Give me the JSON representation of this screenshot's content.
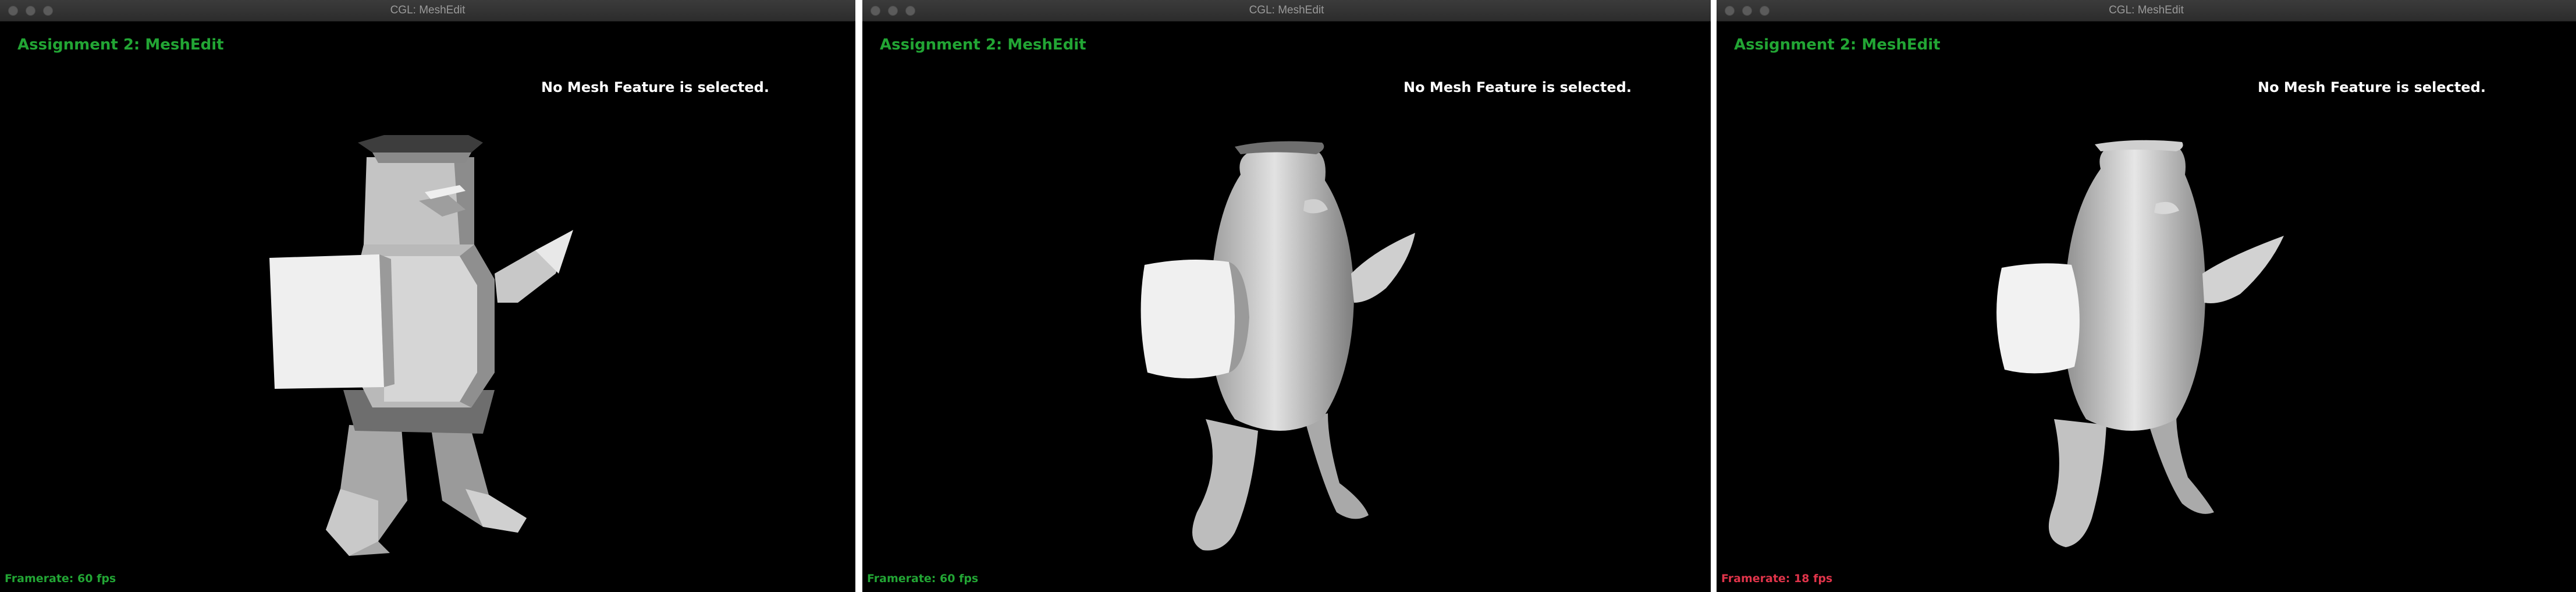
{
  "windows": [
    {
      "window_title": "CGL: MeshEdit",
      "app_title": "Assignment 2: MeshEdit",
      "status_message": "No Mesh Feature is selected.",
      "framerate": "Framerate: 60 fps",
      "shading": "flat"
    },
    {
      "window_title": "CGL: MeshEdit",
      "app_title": "Assignment 2: MeshEdit",
      "status_message": "No Mesh Feature is selected.",
      "framerate": "Framerate: 60 fps",
      "shading": "subdivided-once"
    },
    {
      "window_title": "CGL: MeshEdit",
      "app_title": "Assignment 2: MeshEdit",
      "status_message": "No Mesh Feature is selected.",
      "framerate": "Framerate: 18 fps",
      "shading": "smooth"
    }
  ],
  "colors": {
    "viewport_background": "#000000",
    "titlebar": "#2f2f2f",
    "app_title_green": "#22a534",
    "framerate_green": "#22a534",
    "framerate_red": "#e0344a"
  },
  "icons": [
    "close-light",
    "minimize-light",
    "zoom-light"
  ]
}
